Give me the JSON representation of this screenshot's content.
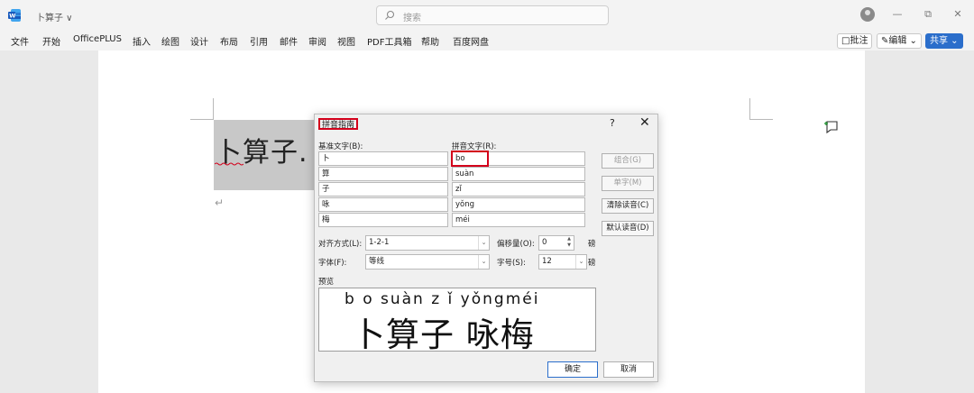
{
  "titlebar": {
    "doc_title": "卜算子 ∨",
    "search_placeholder": "搜索"
  },
  "menu": {
    "items": [
      "文件",
      "开始",
      "OfficePLUS",
      "插入",
      "绘图",
      "设计",
      "布局",
      "引用",
      "邮件",
      "审阅",
      "视图",
      "PDF工具箱",
      "帮助",
      "百度网盘"
    ],
    "comment_button": "□批注",
    "edit_button": "✎编辑 ⌄",
    "share_button": "共享 ⌄"
  },
  "document": {
    "heading": "卜算子.",
    "paragraph_mark": "↵"
  },
  "dialog": {
    "title": "拼音指南",
    "help": "?",
    "close": "✕",
    "base_header": "基准文字(B):",
    "pinyin_header": "拼音文字(R):",
    "rows": [
      {
        "base": "卜",
        "pinyin": "bo"
      },
      {
        "base": "算",
        "pinyin": "suàn"
      },
      {
        "base": "子",
        "pinyin": "zǐ"
      },
      {
        "base": "咏",
        "pinyin": "yǒng"
      },
      {
        "base": "梅",
        "pinyin": "méi"
      }
    ],
    "side_buttons": {
      "group": "组合(G)",
      "single": "单字(M)",
      "clear": "清除读音(C)",
      "default": "默认读音(D)"
    },
    "align_label": "对齐方式(L):",
    "align_value": "1-2-1",
    "offset_label": "偏移量(O):",
    "offset_value": "0",
    "offset_unit": "磅",
    "font_label": "字体(F):",
    "font_value": "等线",
    "size_label": "字号(S):",
    "size_value": "12",
    "size_unit": "磅",
    "preview_label": "预览",
    "preview_ruby": "b o suàn z ǐ   yǒngméi",
    "preview_base": "卜算子 咏梅",
    "ok": "确定",
    "cancel": "取消"
  },
  "colors": {
    "accent": "#2b6ecb",
    "highlight_red": "#d3001b",
    "selection_gray": "#c8c8c8"
  }
}
